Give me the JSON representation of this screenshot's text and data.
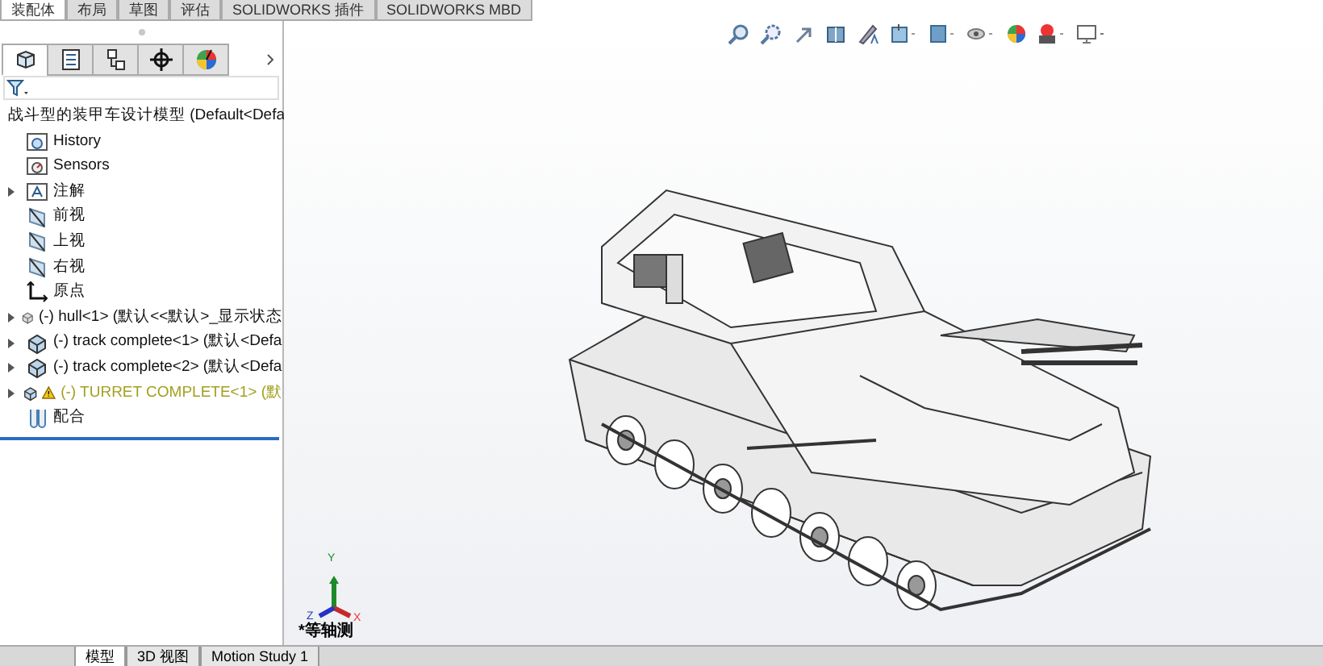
{
  "command_tabs": [
    {
      "label": "装配体",
      "selected": true
    },
    {
      "label": "布局",
      "selected": false
    },
    {
      "label": "草图",
      "selected": false
    },
    {
      "label": "评估",
      "selected": false
    },
    {
      "label": "SOLIDWORKS 插件",
      "selected": false
    },
    {
      "label": "SOLIDWORKS MBD",
      "selected": false
    }
  ],
  "panel_tabs": [
    {
      "kind": "feature-tree",
      "selected": true
    },
    {
      "kind": "property",
      "selected": false
    },
    {
      "kind": "config",
      "selected": false
    },
    {
      "kind": "dimxpert",
      "selected": false
    },
    {
      "kind": "display",
      "selected": false
    }
  ],
  "tree": {
    "root": "战斗型的装甲车设计模型  (Default<Defa",
    "items": [
      {
        "kind": "history",
        "label": "History",
        "expandable": false,
        "warning": false
      },
      {
        "kind": "sensors",
        "label": "Sensors",
        "expandable": false,
        "warning": false
      },
      {
        "kind": "annotation",
        "label": "注解",
        "expandable": true,
        "warning": false
      },
      {
        "kind": "plane",
        "label": "前视",
        "expandable": false,
        "warning": false
      },
      {
        "kind": "plane",
        "label": "上视",
        "expandable": false,
        "warning": false
      },
      {
        "kind": "plane",
        "label": "右视",
        "expandable": false,
        "warning": false
      },
      {
        "kind": "origin",
        "label": "原点",
        "expandable": false,
        "warning": false
      },
      {
        "kind": "part",
        "label": "(-) hull<1> (默认<<默认>_显示状态",
        "expandable": true,
        "warning": false
      },
      {
        "kind": "assembly",
        "label": "(-) track complete<1> (默认<Defa",
        "expandable": true,
        "warning": false
      },
      {
        "kind": "assembly",
        "label": "(-) track complete<2> (默认<Defa",
        "expandable": true,
        "warning": false
      },
      {
        "kind": "assembly",
        "label": "(-) TURRET COMPLETE<1> (默",
        "expandable": true,
        "warning": true
      },
      {
        "kind": "mates",
        "label": "配合",
        "expandable": false,
        "warning": false
      }
    ]
  },
  "triad": {
    "y": "Y",
    "x": "X",
    "z": "Z"
  },
  "view_label": "*等轴测",
  "bottom_tabs": [
    {
      "label": "模型",
      "selected": true
    },
    {
      "label": "3D 视图",
      "selected": false
    },
    {
      "label": "Motion Study 1",
      "selected": false
    }
  ]
}
